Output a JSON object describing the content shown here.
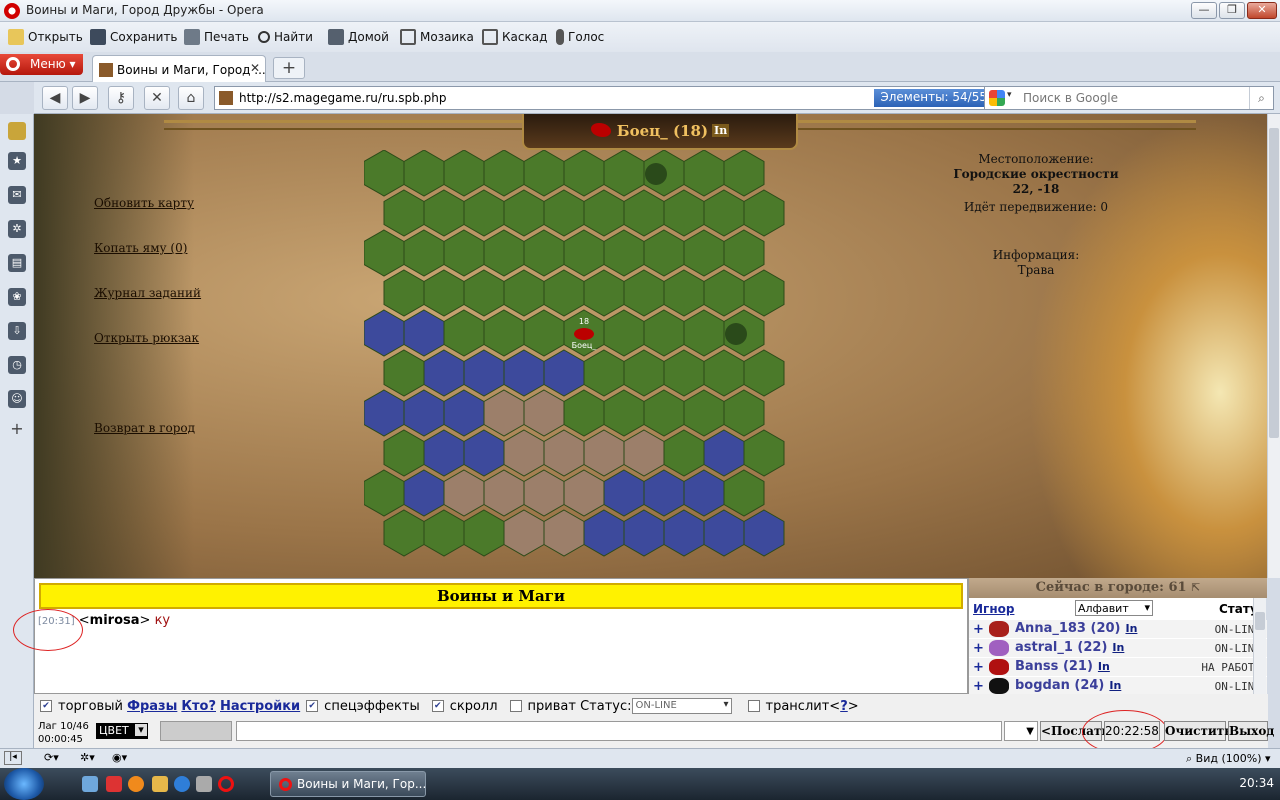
{
  "window": {
    "title": "Воины и Маги, Город Дружбы - Opera"
  },
  "toolbar": {
    "open": "Открыть",
    "save": "Сохранить",
    "print": "Печать",
    "find": "Найти",
    "home": "Домой",
    "mosaic": "Мозаика",
    "cascade": "Каскад",
    "voice": "Голос"
  },
  "tabs": {
    "menu": "Меню",
    "active": "Воины и Маги, Город ..."
  },
  "address": {
    "url": "http://s2.magegame.ru/ru.spb.php",
    "elements": "Элементы:  54/55",
    "search_placeholder": "Поиск в Google"
  },
  "game": {
    "hero": {
      "name": "Боец_ (18)",
      "in": "In",
      "map_level": "18",
      "map_name": "Боец_"
    },
    "links": [
      "Обновить карту",
      "Копать яму (0)",
      "Журнал заданий",
      "Открыть рюкзак",
      "Возврат в город"
    ],
    "location": {
      "label": "Местоположение:",
      "place": "Городские окрестности",
      "coords": "22, -18",
      "moving": "Идёт передвижение: 0",
      "info_label": "Информация:",
      "terrain": "Трава"
    }
  },
  "chat": {
    "title": "Воины и Маги",
    "messages": [
      {
        "time": "[20:31]",
        "nick": "mirosa",
        "text": "ку"
      }
    ],
    "options": {
      "trade": "торговый",
      "phrases": "Фразы",
      "who": "Кто?",
      "settings": "Настройки",
      "effects": "спецэффекты",
      "scroll": "скролл",
      "private": "приват",
      "status_label": "Статус:",
      "status_value": "ON-LINE",
      "translit": "транслит",
      "help": "?"
    },
    "lag": "Лаг 10/46",
    "lag_time": "00:00:45",
    "color": "ЦВЕТ",
    "send": "<Послать",
    "clock": "20:22:58",
    "clear": "Очистить",
    "exit": "Выход"
  },
  "online": {
    "header": "Сейчас в городе: 61",
    "ignore": "Игнор",
    "sort": "Алфавит",
    "status_col": "Статус",
    "users": [
      {
        "name": "Anna_183 (20)",
        "in": "In",
        "status": "ON-LINE",
        "color": "#a8201a"
      },
      {
        "name": "astral_1 (22)",
        "in": "In",
        "status": "ON-LINE",
        "color": "#a060c0"
      },
      {
        "name": "Banss (21)",
        "in": "In",
        "status": "НА РАБОТЕ",
        "color": "#b01010"
      },
      {
        "name": "bogdan (24)",
        "in": "In",
        "status": "ON-LINE",
        "color": "#111111"
      }
    ]
  },
  "statusbar": {
    "zoom": "Вид (100%)"
  },
  "taskbar": {
    "task": "Воины и Маги, Гор...",
    "time": "20:34"
  },
  "hexmap": {
    "rows": [
      "GGGGGGGGGG",
      "GGGGGGGGGG",
      "GGGGGGGGGG",
      "GGGGGGGGGG",
      "WWGGGGGGGG",
      "GWWWWGGGGG",
      "WWWMMGGGGG",
      "GWWMMMMGWG",
      "GWMMMMWWWG",
      "GGGMMWWWWW"
    ],
    "colors": {
      "G": "#4b7a2a",
      "W": "#3d4a9c",
      "M": "#9c7f6a"
    }
  }
}
